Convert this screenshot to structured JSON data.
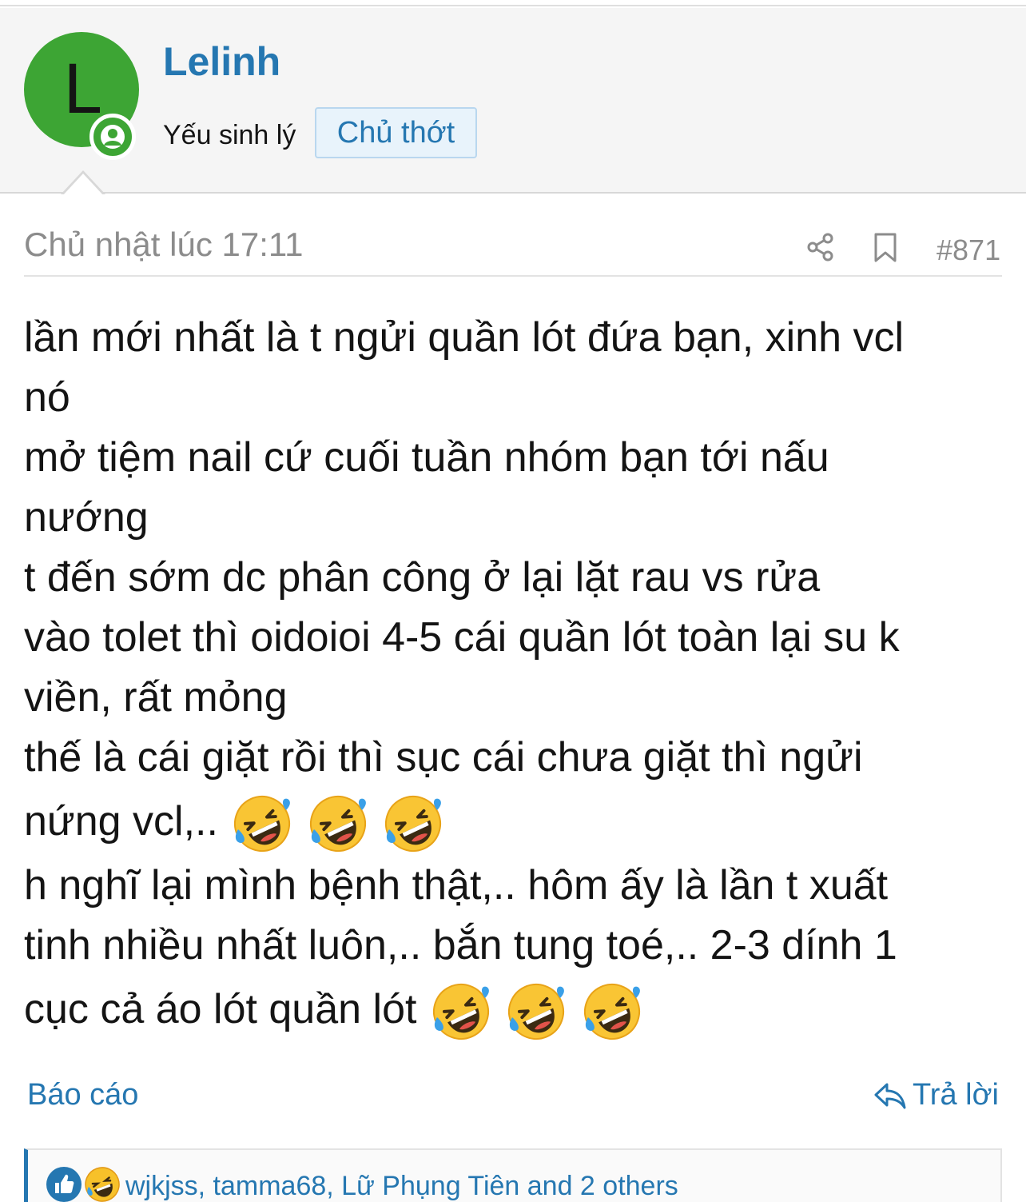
{
  "user": {
    "avatar_letter": "L",
    "username": "Lelinh",
    "title": "Yếu sinh lý",
    "badge": "Chủ thớt",
    "avatar_color": "#3da534"
  },
  "post": {
    "date": "Chủ nhật lúc 17:11",
    "number": "#871",
    "lines": [
      "lần mới nhất là t ngửi quần lót đứa bạn, xinh vcl",
      "nó",
      "mở tiệm nail cứ cuối tuần nhóm bạn tới nấu",
      "nướng",
      "t đến sớm dc phân công ở lại lặt rau vs rửa",
      "vào tolet thì oidoioi 4-5 cái quần lót toàn lại su k",
      "viền, rất mỏng",
      "thế là cái giặt rồi thì sục cái chưa giặt thì ngửi",
      "nứng vcl,..",
      "h nghĩ lại mình bệnh thật,.. hôm ấy là lần t xuất",
      "tinh nhiều nhất luôn,.. bắn tung toé,.. 2-3 dính 1",
      "cục cả áo lót quần lót"
    ],
    "emoji_name": "rolling-on-floor-laughing-icon"
  },
  "actions": {
    "report": "Báo cáo",
    "reply": "Trả lời"
  },
  "reactions": {
    "icons": [
      "like-icon",
      "haha-icon"
    ],
    "users": "wjkjss, tamma68, Lữ Phụng Tiên and 2 others"
  },
  "colors": {
    "link": "#2577b1",
    "muted": "#8c8c8c",
    "header_bg": "#f5f5f5"
  }
}
